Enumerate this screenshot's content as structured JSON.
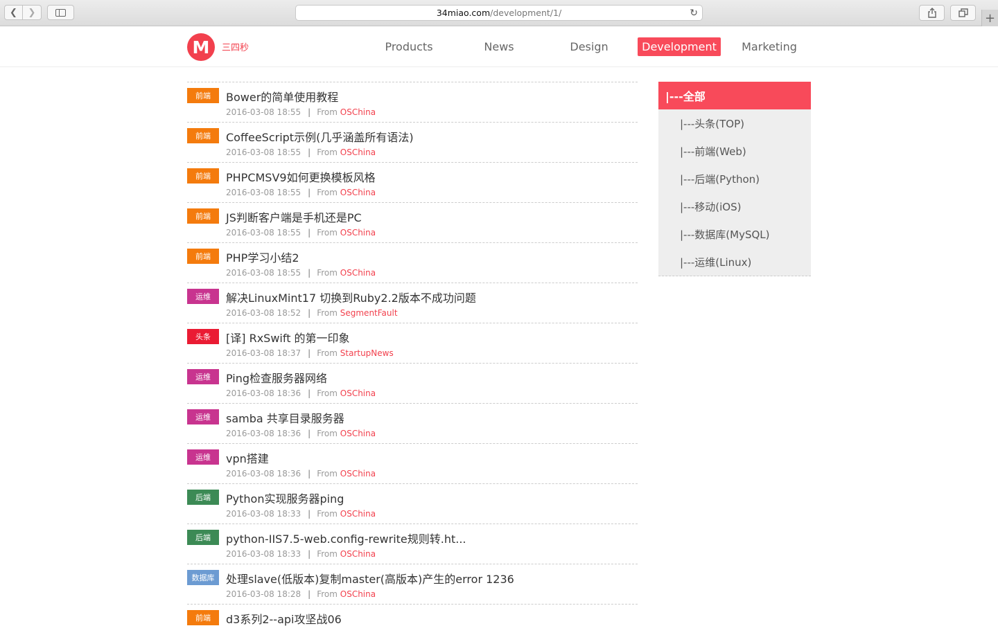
{
  "browser": {
    "url_host": "34miao.com",
    "url_path": "/development/1/"
  },
  "site": {
    "logo_letter": "M",
    "logo_text": "三四秒",
    "nav": [
      "Products",
      "News",
      "Design",
      "Development",
      "Marketing"
    ],
    "active_nav": "Development"
  },
  "colors": {
    "accent": "#f84a5a",
    "badge_frontend": "#f47b0d",
    "badge_ops": "#c8348f",
    "badge_top": "#ea1b33",
    "badge_backend": "#3c8a55",
    "badge_db": "#6c9bd2"
  },
  "articles": [
    {
      "tag": "前端",
      "title": "Bower的简单使用教程",
      "date": "2016-03-08 18:55",
      "from": "From",
      "source": "OSChina"
    },
    {
      "tag": "前端",
      "title": "CoffeeScript示例(几乎涵盖所有语法)",
      "date": "2016-03-08 18:55",
      "from": "From",
      "source": "OSChina"
    },
    {
      "tag": "前端",
      "title": "PHPCMSV9如何更换模板风格",
      "date": "2016-03-08 18:55",
      "from": "From",
      "source": "OSChina"
    },
    {
      "tag": "前端",
      "title": "JS判断客户端是手机还是PC",
      "date": "2016-03-08 18:55",
      "from": "From",
      "source": "OSChina"
    },
    {
      "tag": "前端",
      "title": "PHP学习小结2",
      "date": "2016-03-08 18:55",
      "from": "From",
      "source": "OSChina"
    },
    {
      "tag": "运维",
      "title": "解决LinuxMint17 切换到Ruby2.2版本不成功问题",
      "date": "2016-03-08 18:52",
      "from": "From",
      "source": "SegmentFault"
    },
    {
      "tag": "头条",
      "title": "[译] RxSwift 的第一印象",
      "date": "2016-03-08 18:37",
      "from": "From",
      "source": "StartupNews"
    },
    {
      "tag": "运维",
      "title": "Ping检查服务器网络",
      "date": "2016-03-08 18:36",
      "from": "From",
      "source": "OSChina"
    },
    {
      "tag": "运维",
      "title": "samba 共享目录服务器",
      "date": "2016-03-08 18:36",
      "from": "From",
      "source": "OSChina"
    },
    {
      "tag": "运维",
      "title": "vpn搭建",
      "date": "2016-03-08 18:36",
      "from": "From",
      "source": "OSChina"
    },
    {
      "tag": "后端",
      "title": "Python实现服务器ping",
      "date": "2016-03-08 18:33",
      "from": "From",
      "source": "OSChina"
    },
    {
      "tag": "后端",
      "title": "python-IIS7.5-web.config-rewrite规则转.ht...",
      "date": "2016-03-08 18:33",
      "from": "From",
      "source": "OSChina"
    },
    {
      "tag": "数据库",
      "title": "处理slave(低版本)复制master(高版本)产生的error 1236",
      "date": "2016-03-08 18:28",
      "from": "From",
      "source": "OSChina"
    },
    {
      "tag": "前端",
      "title": "d3系列2--api攻坚战06",
      "date": "",
      "from": "",
      "source": ""
    }
  ],
  "categories": {
    "header": "|---全部",
    "items": [
      "|---头条(TOP)",
      "|---前端(Web)",
      "|---后端(Python)",
      "|---移动(iOS)",
      "|---数据库(MySQL)",
      "|---运维(Linux)"
    ]
  }
}
